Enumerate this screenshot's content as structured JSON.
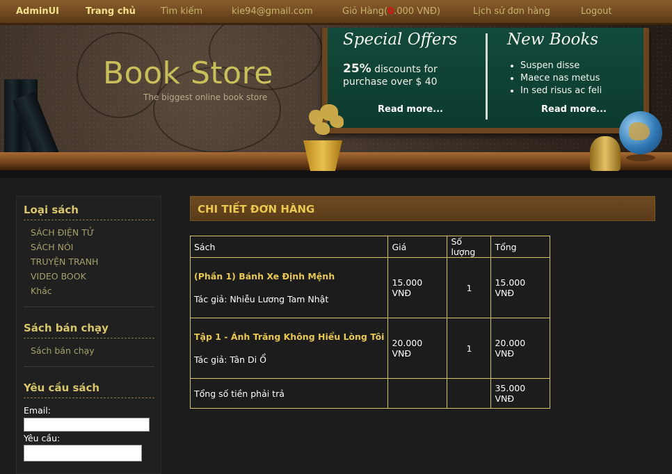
{
  "nav": {
    "items": [
      {
        "label": "AdminUI",
        "style": "strong"
      },
      {
        "label": "Trang chủ",
        "style": "strong"
      },
      {
        "label": "Tìm kiếm",
        "style": "muted"
      },
      {
        "label": "kie94@gmail.com",
        "style": "muted"
      },
      {
        "label": "Lịch sử đơn hàng",
        "style": "muted"
      },
      {
        "label": "Logout",
        "style": "muted"
      }
    ],
    "cart_prefix": "Giỏ Hàng(",
    "cart_count": "0",
    "cart_suffix": ".000 VNĐ)"
  },
  "header": {
    "title": "Book Store",
    "tagline": "The biggest online book store",
    "offers": {
      "title": "Special Offers",
      "percent": "25%",
      "text_a": " discounts for",
      "text_b": "purchase over $ 40",
      "read_more": "Read more..."
    },
    "new_books": {
      "title": "New Books",
      "items": [
        "Suspen disse",
        "Maece nas metus",
        "In sed risus ac feli"
      ],
      "read_more": "Read more..."
    }
  },
  "sidebar": {
    "categories_title": "Loại sách",
    "categories": [
      "SÁCH ĐIỆN TỬ",
      "SÁCH NÓI",
      "TRUYỆN TRANH",
      "VIDEO BOOK",
      "Khác"
    ],
    "bestseller_title": "Sách bán chạy",
    "bestseller_link": "Sách bán chạy",
    "request_title": "Yêu cầu sách",
    "email_label": "Email:",
    "email_value": "",
    "request_label": "Yêu cầu:",
    "request_value": ""
  },
  "main": {
    "section_title": "CHI TIẾT ĐƠN HÀNG",
    "table": {
      "headers": [
        "Sách",
        "Giá",
        "Số lượng",
        "Tổng"
      ],
      "rows": [
        {
          "name": "(Phần 1) Bánh Xe Định Mệnh",
          "author": "Tác giả: Nhiễu Lương Tam Nhật",
          "price": "15.000 VNĐ",
          "qty": "1",
          "total": "15.000 VNĐ"
        },
        {
          "name": "Tập 1 - Ánh Trăng Không Hiểu Lòng Tôi",
          "author": "Tác giả: Tân Di Ổ",
          "price": "20.000 VNĐ",
          "qty": "1",
          "total": "20.000 VNĐ"
        }
      ],
      "grand_total_label": "Tổng số tiền phải trả",
      "grand_total": "35.000 VNĐ"
    }
  }
}
